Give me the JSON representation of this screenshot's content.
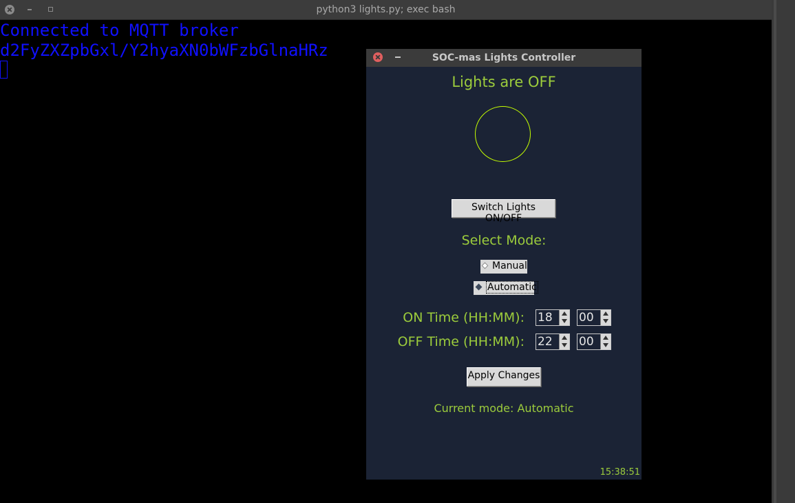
{
  "terminal": {
    "title": "python3 lights.py; exec bash",
    "lines": [
      "Connected to MQTT broker",
      "d2FyZXZpbGxl/Y2hyaXN0bWFzbGlnaHRz"
    ]
  },
  "app": {
    "title": "SOC-mas Lights Controller",
    "status": "Lights are OFF",
    "switch_button": "Switch Lights ON/OFF",
    "mode_label": "Select Mode:",
    "modes": [
      {
        "label": "Manual",
        "selected": false
      },
      {
        "label": "Automatic",
        "selected": true
      }
    ],
    "on_time_label": "ON Time (HH:MM):",
    "on_hour": "18",
    "on_minute": "00",
    "off_time_label": "OFF Time (HH:MM):",
    "off_hour": "22",
    "off_minute": "00",
    "apply_button": "Apply Changes",
    "current_mode": "Current mode: Automatic",
    "clock": "15:38:51",
    "colors": {
      "accent": "#9ccc3c",
      "bulb_outline": "#c6ff00",
      "background": "#1b2335"
    }
  }
}
